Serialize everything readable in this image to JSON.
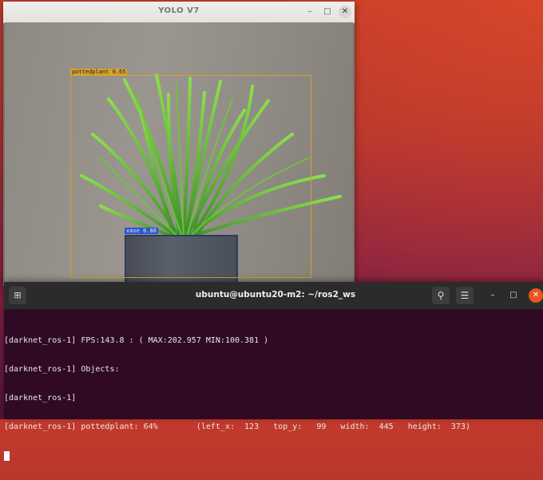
{
  "yolo_window": {
    "title": "YOLO V7",
    "detections": [
      {
        "label": "pottedplant 0.65",
        "color": "#d7a22a"
      },
      {
        "label": "vase 0.88",
        "color": "#2b57c9"
      }
    ]
  },
  "terminal": {
    "title": "ubuntu@ubuntu20-m2: ~/ros2_ws",
    "lines": [
      "[darknet_ros-1] FPS:143.8 : ( MAX:202.957 MIN:100.381 )",
      "[darknet_ros-1] Objects:",
      "[darknet_ros-1]",
      "[darknet_ros-1] pottedplant: 64%        (left_x:  123   top_y:   99   width:  445   height:  373)"
    ],
    "theme": {
      "background": "#300a24",
      "close_color": "#e9541f"
    }
  },
  "icons": {
    "new_tab": "new-tab-icon",
    "search": "search-icon",
    "menu": "hamburger-menu-icon",
    "minimize": "minimize-icon",
    "maximize": "maximize-icon",
    "close": "close-icon"
  }
}
